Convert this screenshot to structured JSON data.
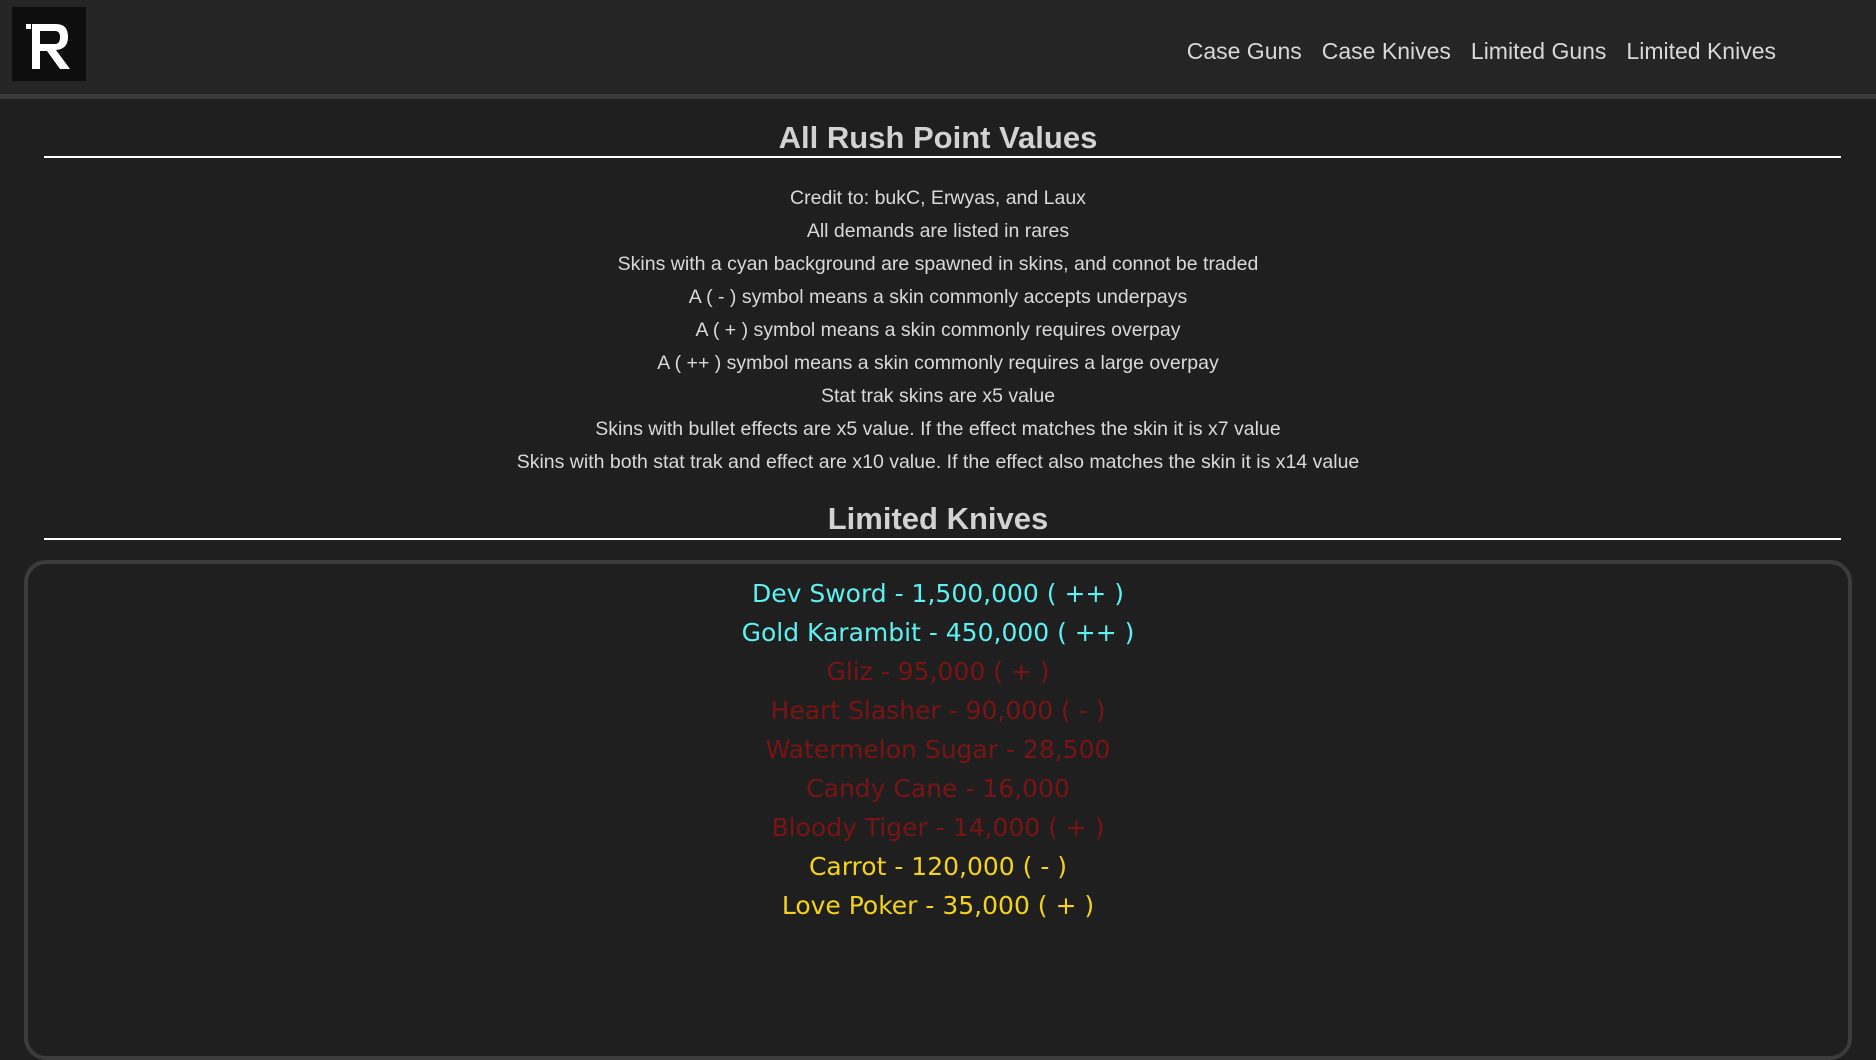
{
  "nav": {
    "logo_letter": "R",
    "links": [
      "Case Guns",
      "Case Knives",
      "Limited Guns",
      "Limited Knives"
    ]
  },
  "header": {
    "title": "All Rush Point Values"
  },
  "notes": [
    "Credit to: bukC, Erwyas, and Laux",
    "All demands are listed in rares",
    "Skins with a cyan background are spawned in skins, and connot be traded",
    "A ( - ) symbol means a skin commonly accepts underpays",
    "A ( + ) symbol means a skin commonly requires overpay",
    "A ( ++ ) symbol means a skin commonly requires a large overpay",
    "Stat trak skins are x5 value",
    "Skins with bullet effects are x5 value. If the effect matches the skin it is x7 value",
    "Skins with both stat trak and effect are x10 value. If the effect also matches the skin it is x14 value"
  ],
  "section": {
    "title": "Limited Knives"
  },
  "colors": {
    "cyan": "#5ff0f0",
    "red": "#7a1414",
    "yellow": "#f5d31a"
  },
  "items": [
    {
      "text": "Dev Sword - 1,500,000 ( ++ )",
      "color": "#5ff0f0"
    },
    {
      "text": "Gold Karambit - 450,000 ( ++ )",
      "color": "#5ff0f0"
    },
    {
      "text": "Gliz - 95,000 ( + )",
      "color": "#7a1414"
    },
    {
      "text": "Heart Slasher - 90,000 ( - )",
      "color": "#7a1414"
    },
    {
      "text": "Watermelon Sugar - 28,500",
      "color": "#7a1414"
    },
    {
      "text": "Candy Cane - 16,000",
      "color": "#7a1414"
    },
    {
      "text": "Bloody Tiger - 14,000 ( + )",
      "color": "#7a1414"
    },
    {
      "text": "Carrot - 120,000 ( - )",
      "color": "#f5d31a"
    },
    {
      "text": "Love Poker - 35,000 ( + )",
      "color": "#f5d31a"
    }
  ]
}
